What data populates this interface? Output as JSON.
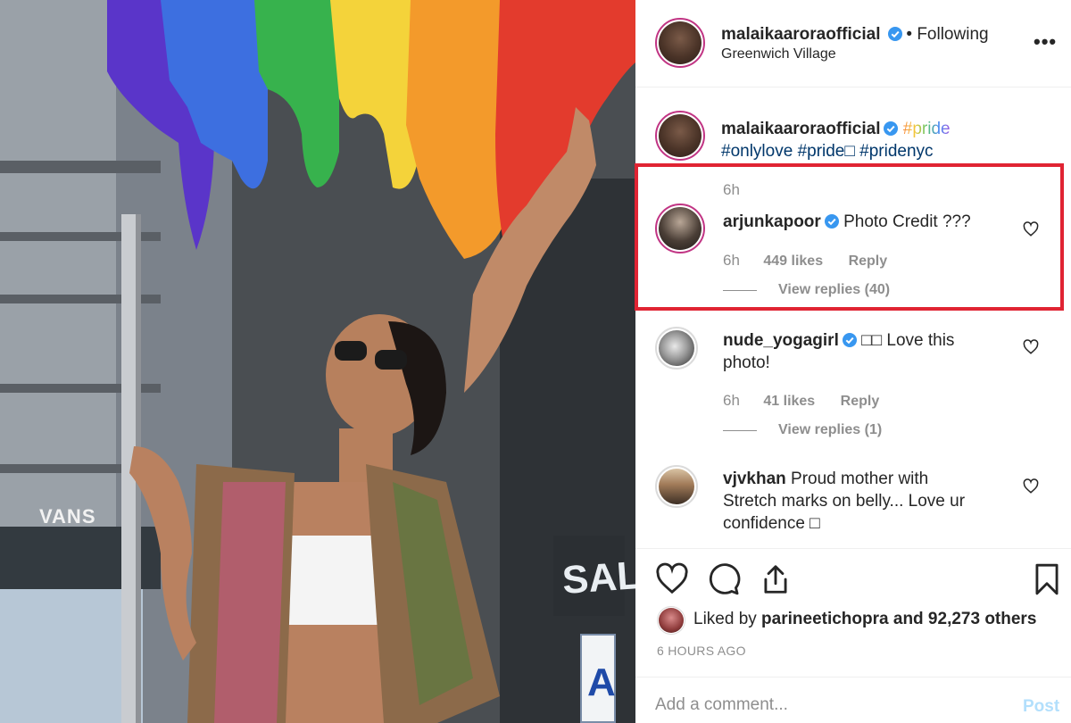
{
  "post": {
    "author": "malaikaaroraofficial",
    "follow_status": "• Following",
    "location": "Greenwich Village",
    "more_label": "•••",
    "caption": {
      "author": "malaikaaroraofficial",
      "tags": [
        "#pride",
        "#onlylove",
        "#pride□",
        "#pridenyc"
      ]
    },
    "caption_time": "6h"
  },
  "comments": [
    {
      "user": "arjunkapoor",
      "verified": true,
      "text": "Photo Credit ???",
      "time": "6h",
      "likes": "449 likes",
      "reply": "Reply",
      "view_replies": "View replies (40)",
      "highlighted": true
    },
    {
      "user": "nude_yogagirl",
      "verified": true,
      "text_line1": "□□ Love this",
      "text_line2": "photo!",
      "time": "6h",
      "likes": "41 likes",
      "reply": "Reply",
      "view_replies": "View replies (1)"
    },
    {
      "user": "vjvkhan",
      "verified": false,
      "text_line1": "Proud mother with",
      "text_line2": "Stretch marks on belly... Love ur",
      "text_line3": "confidence □"
    }
  ],
  "liked_by": {
    "prefix": "Liked by ",
    "user": "parineetichopra",
    "suffix": " and 92,273 others"
  },
  "timestamp": "6 HOURS AGO",
  "add_comment": {
    "placeholder": "Add a comment...",
    "post_label": "Post"
  },
  "photo": {
    "sign_vans": "VANS",
    "sign_sale": "SALE",
    "sign_a": "A"
  },
  "colors": {
    "highlight_border": "#e02433",
    "verified_blue": "#3897f0",
    "post_button": "#b2dffc",
    "muted": "#8e8e8e"
  }
}
